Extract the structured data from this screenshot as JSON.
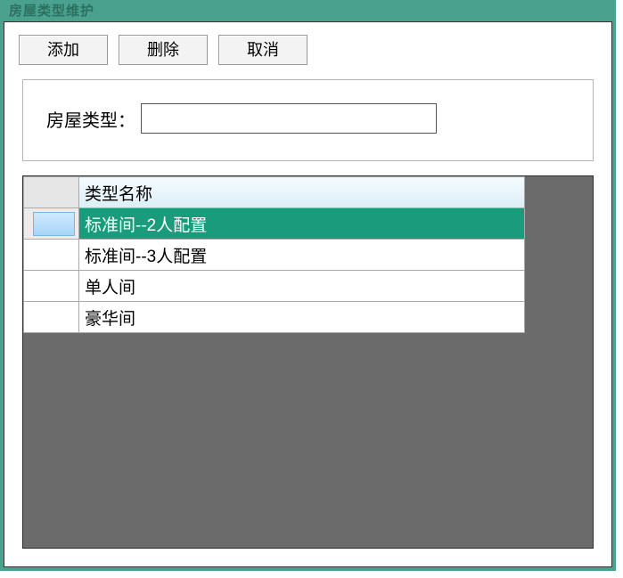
{
  "window": {
    "title": "房屋类型维护"
  },
  "toolbar": {
    "add_label": "添加",
    "delete_label": "删除",
    "cancel_label": "取消"
  },
  "form": {
    "type_label": "房屋类型：",
    "type_value": ""
  },
  "grid": {
    "column_header": "类型名称",
    "rows": [
      {
        "name": "标准间--2人配置",
        "selected": true
      },
      {
        "name": "标准间--3人配置",
        "selected": false
      },
      {
        "name": "单人间",
        "selected": false
      },
      {
        "name": "豪华间",
        "selected": false
      }
    ]
  }
}
